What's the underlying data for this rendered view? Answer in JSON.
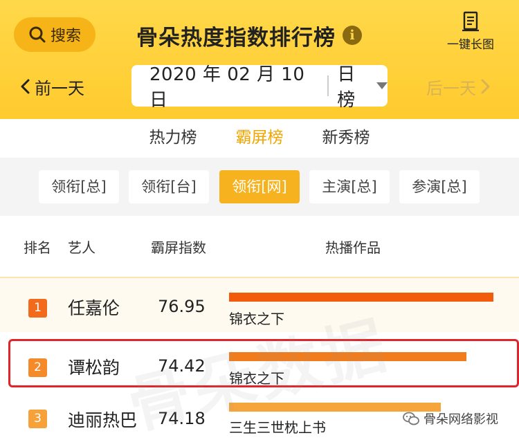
{
  "header": {
    "search_label": "搜索",
    "title": "骨朵热度指数排行榜",
    "info_icon": "info-icon",
    "long_image_label": "一键长图",
    "prev_day_label": "前一天",
    "next_day_label": "后一天",
    "date": "2020 年 02 月 10 日",
    "mode": "日榜"
  },
  "tabs": [
    {
      "label": "热力榜",
      "active": false
    },
    {
      "label": "霸屏榜",
      "active": true
    },
    {
      "label": "新秀榜",
      "active": false
    }
  ],
  "filters": [
    {
      "label": "领衔[总]",
      "active": false
    },
    {
      "label": "领衔[台]",
      "active": false
    },
    {
      "label": "领衔[网]",
      "active": true
    },
    {
      "label": "主演[总]",
      "active": false
    },
    {
      "label": "参演[总]",
      "active": false
    }
  ],
  "table": {
    "headers": {
      "rank": "排名",
      "artist": "艺人",
      "score": "霸屏指数",
      "works": "热播作品"
    },
    "rows": [
      {
        "rank": "1",
        "artist": "任嘉伦",
        "score": "76.95",
        "work": "锦衣之下",
        "bar_fraction": 1.0,
        "badge_color": "#f26b1d",
        "bar_color": "#f25a0c"
      },
      {
        "rank": "2",
        "artist": "谭松韵",
        "score": "74.42",
        "work": "锦衣之下",
        "bar_fraction": 0.897,
        "badge_color": "#f58a2a",
        "bar_color": "#f27c1c"
      },
      {
        "rank": "3",
        "artist": "迪丽热巴",
        "score": "74.18",
        "work": "三生三世枕上书",
        "bar_fraction": 0.8,
        "badge_color": "#f6a13a",
        "bar_color": "#f5a53c"
      }
    ]
  },
  "watermark": "骨朵数据",
  "wechat_account": "骨朵网络影视",
  "colors": {
    "accent": "#ffcb2e",
    "active_tab": "#f0a500",
    "highlight": "#e0242a"
  }
}
